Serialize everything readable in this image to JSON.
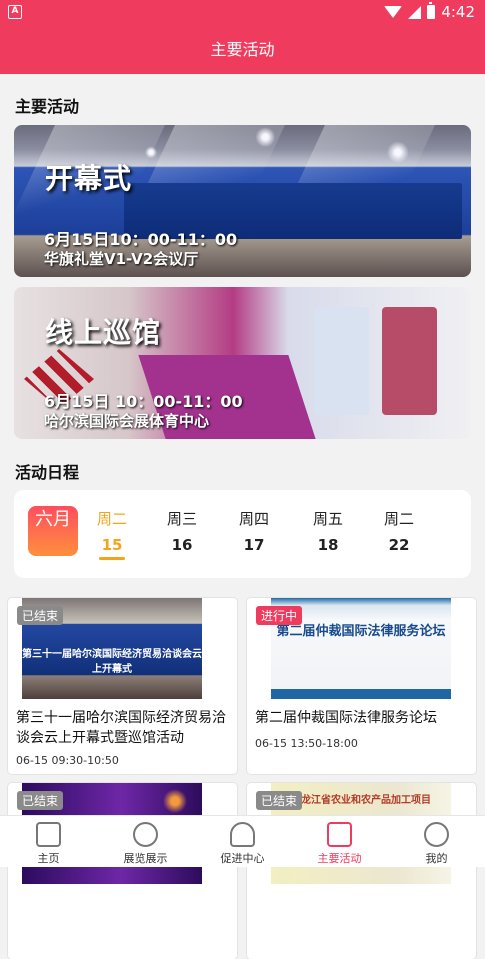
{
  "status": {
    "time": "4:42",
    "left_badge": "A"
  },
  "header": {
    "title": "主要活动"
  },
  "main": {
    "activities_title": "主要活动",
    "banners": [
      {
        "title": "开幕式",
        "time": "6月15日10：00-11：00",
        "venue": "华旗礼堂V1-V2会议厅"
      },
      {
        "title": "线上巡馆",
        "time": "6月15日 10：00-11：00",
        "venue": "哈尔滨国际会展体育中心"
      }
    ],
    "schedule_title": "活动日程",
    "month": "六月",
    "days": [
      {
        "weekday": "周二",
        "date": "15",
        "active": true
      },
      {
        "weekday": "周三",
        "date": "16"
      },
      {
        "weekday": "周四",
        "date": "17"
      },
      {
        "weekday": "周五",
        "date": "18"
      },
      {
        "weekday": "周二",
        "date": "22"
      }
    ],
    "events": [
      {
        "status": "已结束",
        "title": "第三十一届哈尔滨国际经济贸易洽谈会云上开幕式暨巡馆活动",
        "time": "06-15  09:30-10:50",
        "thumb_text": "第三十一届哈尔滨国际经济贸易洽谈会云上开幕式"
      },
      {
        "status": "进行中",
        "title": "第二届仲裁国际法律服务论坛",
        "time": "06-15  13:50-18:00",
        "thumb_text": "第二届仲裁国际法律服务论坛"
      },
      {
        "status": "已结束",
        "title": "",
        "time": "",
        "thumb_text": ""
      },
      {
        "status": "已结束",
        "title": "",
        "time": "",
        "thumb_text": "黑龙江省农业和农产品加工项目"
      }
    ]
  },
  "nav": {
    "items": [
      {
        "label": "主页",
        "icon": "home-icon"
      },
      {
        "label": "展览展示",
        "icon": "exhibition-icon"
      },
      {
        "label": "促进中心",
        "icon": "promotion-icon"
      },
      {
        "label": "主要活动",
        "icon": "activity-icon",
        "active": true
      },
      {
        "label": "我的",
        "icon": "profile-icon"
      }
    ]
  },
  "colors": {
    "brand": "#ef3b5e",
    "active_day": "#f2a51c"
  }
}
